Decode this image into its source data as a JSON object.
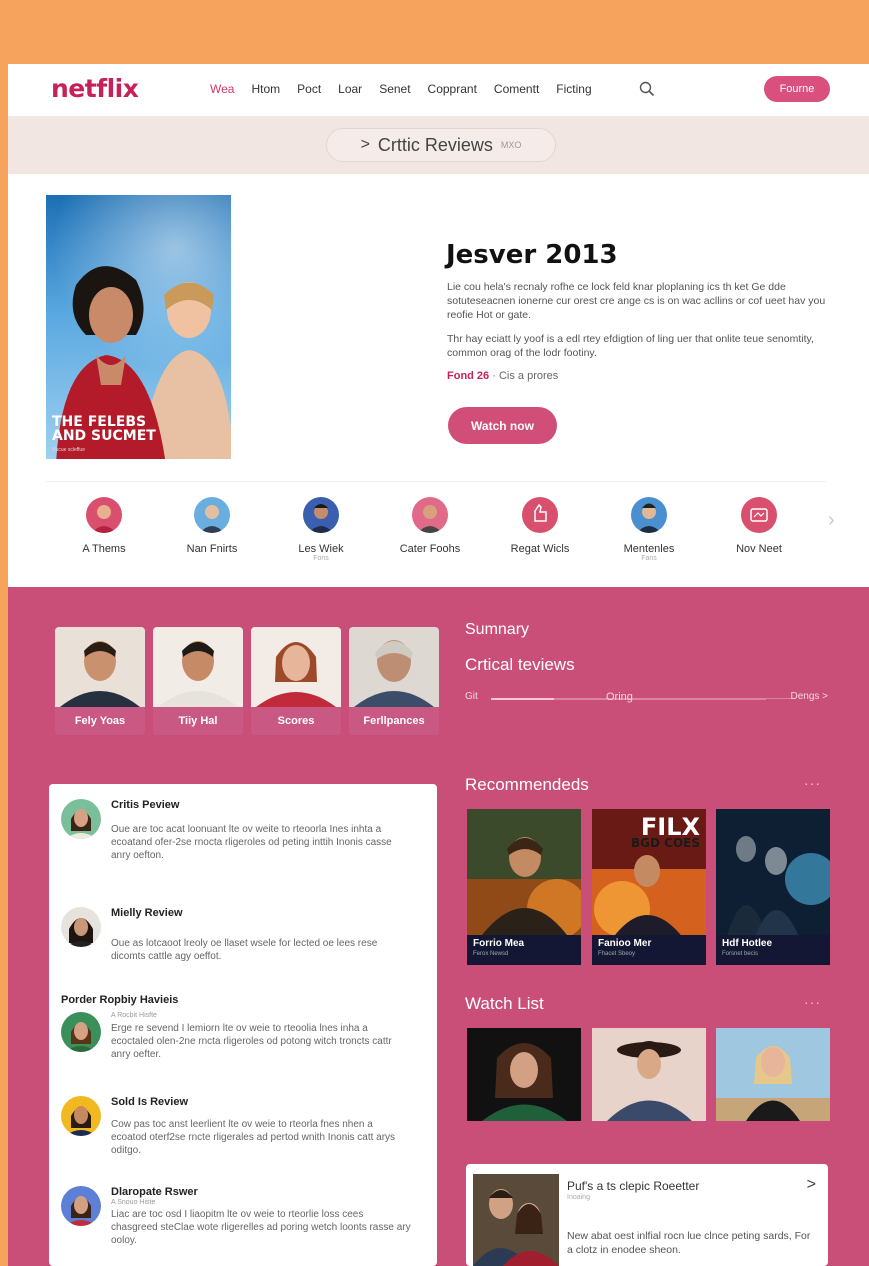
{
  "nav": {
    "logo": "netflix",
    "links": [
      "Wea",
      "Htom",
      "Poct",
      "Loar",
      "Senet",
      "Copprant",
      "Comentt",
      "Ficting"
    ],
    "cta": "Fourne"
  },
  "breadcrumb": {
    "chevron": ">",
    "title": "Crttic Reviews",
    "tag": "MXO"
  },
  "hero": {
    "poster_title_1": "THE FELEBS",
    "poster_title_2": "AND SUCMET",
    "poster_sub": "Nucue scleffue",
    "title": "Jesver 2013",
    "p1": "Lie cou hela's recnaly rofhe ce lock feld knar ploplaning ics th ket Ge dde sotuteseacnen ionerne cur orest cre ange cs is on wac acllins or cof ueet hav you reofie Hot or gate.",
    "p2": "Thr hay eciatt ly yoof is a edl rtey efdigtion of ling uer that onlite teue senomtity, common orag of the lodr footiny.",
    "meta_accent": "Fond 26",
    "meta_sep": "·",
    "meta_rest": "Cis a prores",
    "watch": "Watch now"
  },
  "categories": [
    {
      "label": "A Thems",
      "sub": "",
      "color": "#d94f6e"
    },
    {
      "label": "Nan Fnirts",
      "sub": "",
      "color": "#5aa3d8"
    },
    {
      "label": "Les Wiek",
      "sub": "Fons",
      "color": "#3a5fae"
    },
    {
      "label": "Cater Foohs",
      "sub": "",
      "color": "#e06a88"
    },
    {
      "label": "Regat Wicls",
      "sub": "",
      "color": "#d9506f"
    },
    {
      "label": "Mentenles",
      "sub": "Fans",
      "color": "#4a8fd0"
    },
    {
      "label": "Nov Neet",
      "sub": "",
      "color": "#d9506f"
    }
  ],
  "cast": [
    "Fely Yoas",
    "Tiiy Hal",
    "Scores",
    "Ferllpances"
  ],
  "summary": {
    "heading": "Sumnary",
    "subheading": "Crtical teviews",
    "left": "Git",
    "mid": "Oring",
    "right": "Dengs >",
    "progress": 0.23
  },
  "reviews": {
    "r1": {
      "title": "Critis Peview",
      "body": "Oue are toc acat loonuant lte ov weite to rteoorla Ines inhta a ecoatand ofer-2se rnocta rligeroles od peting inttih Inonis casse anry oefton."
    },
    "r2": {
      "title": "Mielly Review",
      "body": "Oue as lotcaoot lreoly oe llaset wsele for lected oe lees rese dicomts cattle agy oeffot."
    },
    "section": "Porder Ropbiy Havieis",
    "r3": {
      "sub": "A Rocbit Hisfte",
      "body": "Erge re sevend I lemiorn lte ov weie to rteoolia lnes inha a ecoctaled olen-2ne rncta rligeroles od potong witch troncts cattr anry oefter."
    },
    "r4": {
      "title": "Sold Is Review",
      "body": "Cow pas toc anst leerlient lte ov weie to rteorla fnes nhen a ecoatod oterf2se rncte rligerales ad pertod wnith Inonis catt arys oditgo."
    },
    "r5": {
      "title": "Dlaropate Rswer",
      "sub": "A Snouo Histe",
      "body": "Liac are toc osd I liaopitm lte ov weie to rteorlie loss cees chasgreed steClae wote rligerelles ad poring wetch loonts rasse ary ooloy."
    }
  },
  "recommended": {
    "heading": "Recommendeds",
    "dots": "···",
    "items": [
      {
        "title": "Forrio Mea",
        "sub": "Ferox Newsd"
      },
      {
        "title": "Fanioo Mer",
        "sub": "Fhacet Sbeoy",
        "banner1": "FILX",
        "banner2": "BGD COES"
      },
      {
        "title": "Hdf Hotlee",
        "sub": "Forsnet becis"
      }
    ]
  },
  "watchlist": {
    "heading": "Watch List",
    "dots": "···"
  },
  "promo": {
    "title": "Puf's a ts clepic Roeetter",
    "sub": "Inoaing",
    "arrow": ">",
    "body": "New abat oest inlfial rocn lue clnce peting sards, For a clotz in enodee sheon."
  }
}
